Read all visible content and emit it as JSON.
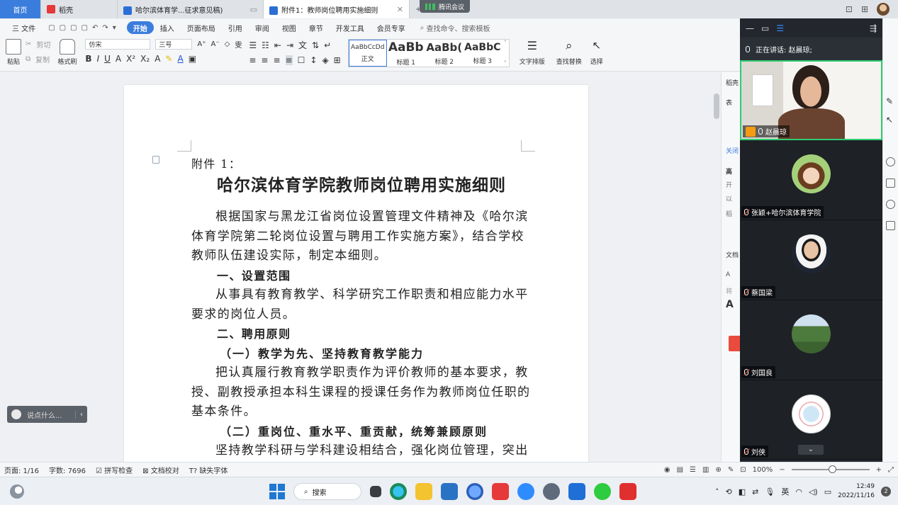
{
  "tabs": [
    {
      "label": "首页"
    },
    {
      "label": "稻壳"
    },
    {
      "label": "哈尔滨体育学...征求意见稿)"
    },
    {
      "label": "附件1：教师岗位聘用实施细则"
    }
  ],
  "meeting_pill": "腾讯会议",
  "menu": {
    "file": "三 文件",
    "items": [
      "开始",
      "插入",
      "页面布局",
      "引用",
      "审阅",
      "视图",
      "章节",
      "开发工具",
      "会员专享"
    ],
    "search": "查找命令、搜索模板"
  },
  "ribbon": {
    "paste": "粘贴",
    "cut": "剪切",
    "copy": "复制",
    "format_painter": "格式刷",
    "font": "仿宋",
    "size": "三号",
    "styles": [
      {
        "sample": "AaBbCcDd",
        "label": "正文"
      },
      {
        "sample": "AaBb",
        "label": "标题 1"
      },
      {
        "sample": "AaBb(",
        "label": "标题 2"
      },
      {
        "sample": "AaBbC",
        "label": "标题 3"
      }
    ],
    "text_layout": "文字排版",
    "find_replace": "查找替换",
    "select": "选择"
  },
  "document": {
    "attach": "附件 1：",
    "title": "哈尔滨体育学院教师岗位聘用实施细则",
    "p1": "根据国家与黑龙江省岗位设置管理文件精神及《哈尔滨体育学院第二轮岗位设置与聘用工作实施方案》，结合学校教师队伍建设实际，制定本细则。",
    "h1a": "一、设置范围",
    "p2": "从事具有教育教学、科学研究工作职责和相应能力水平要求的岗位人员。",
    "h1b": "二、聘用原则",
    "h2a": "（一）教学为先、坚持教育教学能力",
    "p3": "把认真履行教育教学职责作为评价教师的基本要求，教授、副教授承担本科生课程的授课任务作为教师岗位任职的基本条件。",
    "h2b": "（二）重岗位、重水平、重贡献，统筹兼顾原则",
    "p4": "坚持教学科研与学科建设相结合，强化岗位管理，突出业"
  },
  "chat_placeholder": "说点什么...",
  "right_panel": {
    "title": "稻壳",
    "labels": [
      "表",
      "关闭",
      "高",
      "开",
      "以",
      "稻",
      "文档",
      "A",
      "将",
      "A"
    ]
  },
  "meeting": {
    "speaking": "正在讲话: 赵晨琼;",
    "participants": [
      {
        "name": "赵晨琼"
      },
      {
        "name": "张颖+哈尔滨体育学院"
      },
      {
        "name": "蔡国梁"
      },
      {
        "name": "刘国良"
      },
      {
        "name": "刘侠"
      }
    ]
  },
  "status": {
    "page": "页面: 1/16",
    "words": "字数: 7696",
    "spell": "拼写检查",
    "proof": "文档校对",
    "missing_font": "缺失字体",
    "zoom": "100%"
  },
  "taskbar": {
    "search": "搜索",
    "ime": "英",
    "time": "12:49",
    "date": "2022/11/16",
    "notifications": "2"
  }
}
